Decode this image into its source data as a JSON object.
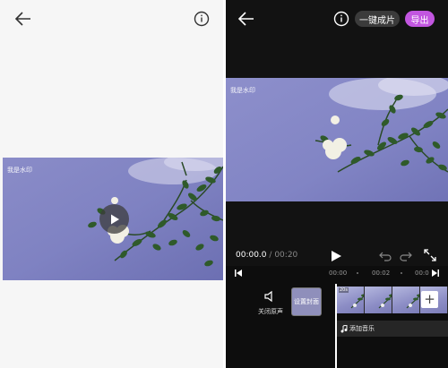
{
  "left_panel": {
    "watermark": "我是水印",
    "icons": {
      "back": "arrow-left-icon",
      "info": "info-icon",
      "play": "play-icon"
    }
  },
  "right_panel": {
    "one_click_label": "一键成片",
    "export_label": "导出",
    "watermark": "我是水印",
    "time_current": "00:00.0",
    "time_separator": "/",
    "time_total": "00:20",
    "ruler_ticks": [
      "00:00",
      "00:02",
      "00:0"
    ],
    "mute_label": "关闭原声",
    "cover_label": "设置封面",
    "clip_duration": "20s",
    "add_music_label": "添加音乐",
    "add_clip_label": "+",
    "icons": {
      "back": "arrow-left-icon",
      "info": "info-icon",
      "play": "play-icon",
      "undo": "undo-icon",
      "redo": "redo-icon",
      "expand": "expand-icon",
      "start": "jump-start-icon",
      "end": "jump-end-icon",
      "mute": "speaker-icon",
      "music": "music-note-icon"
    },
    "accent_color": "#c256e0"
  }
}
